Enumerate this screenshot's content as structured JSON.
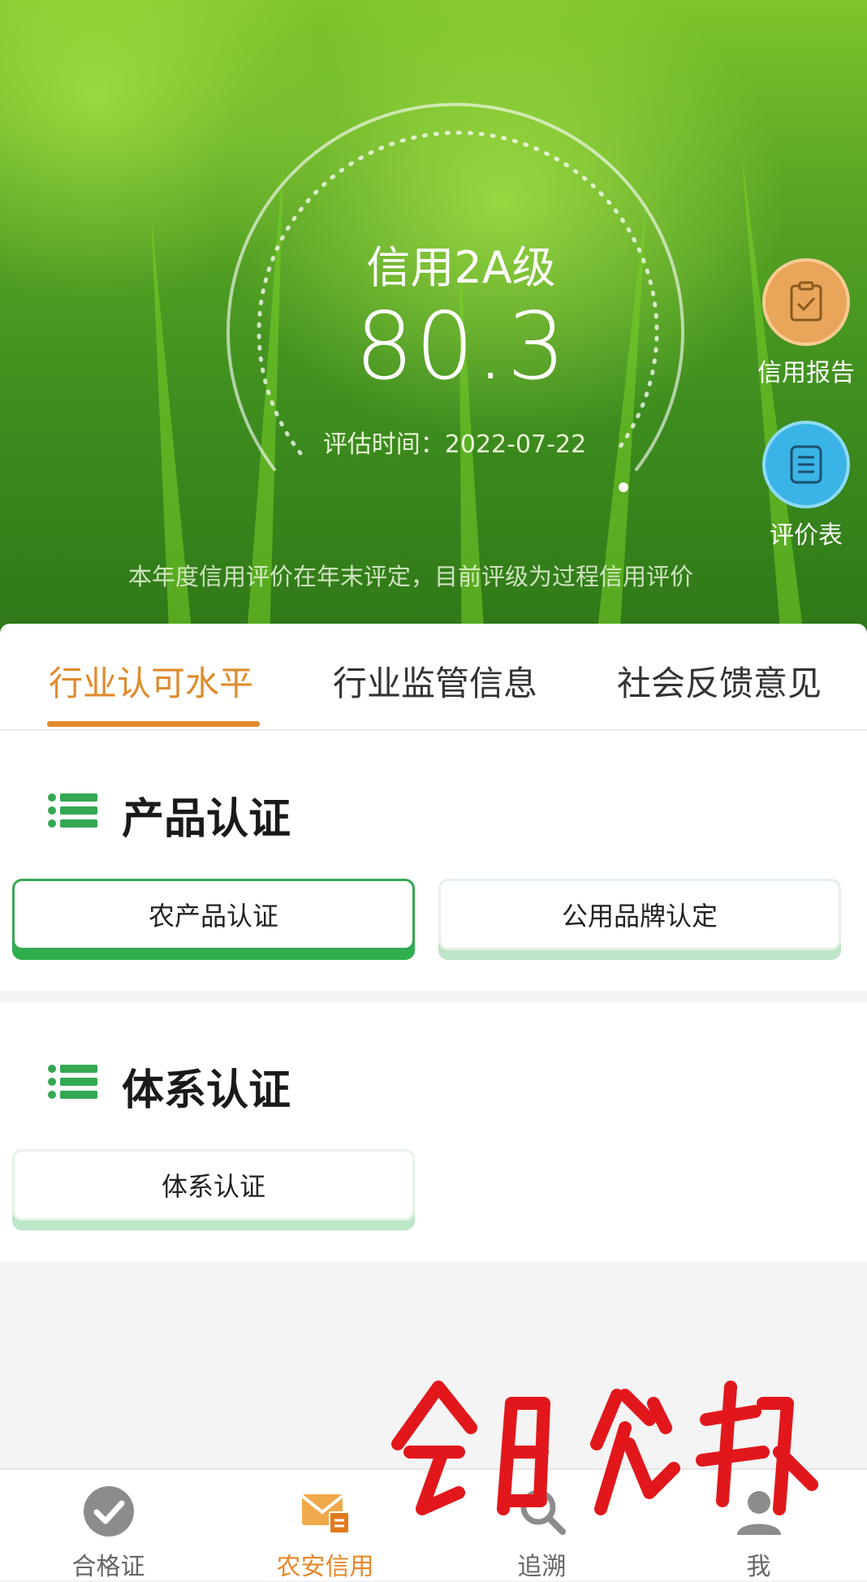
{
  "hero": {
    "credit_level": "信用2A级",
    "score": "80.3",
    "evaluation_time": "评估时间：2022-07-22",
    "note": "本年度信用评价在年末评定，目前评级为过程信用评价"
  },
  "side_buttons": [
    {
      "label": "信用报告",
      "icon": "clipboard-check-icon",
      "color": "#e9a55a"
    },
    {
      "label": "评价表",
      "icon": "document-list-icon",
      "color": "#3ab4e6"
    }
  ],
  "tabs": [
    {
      "label": "行业认可水平",
      "active": true
    },
    {
      "label": "行业监管信息",
      "active": false
    },
    {
      "label": "社会反馈意见",
      "active": false
    }
  ],
  "sections": [
    {
      "title": "产品认证",
      "buttons": [
        {
          "label": "农产品认证",
          "selected": true
        },
        {
          "label": "公用品牌认定",
          "selected": false
        }
      ]
    },
    {
      "title": "体系认证",
      "buttons": [
        {
          "label": "体系认证",
          "selected": false
        }
      ]
    }
  ],
  "bottom_nav": [
    {
      "label": "合格证",
      "icon": "checkmark-circle-icon",
      "active": false
    },
    {
      "label": "农安信用",
      "icon": "envelope-badge-icon",
      "active": true
    },
    {
      "label": "追溯",
      "icon": "magnifier-icon",
      "active": false
    },
    {
      "label": "我",
      "icon": "user-icon",
      "active": false
    }
  ],
  "watermark": "今日花都",
  "colors": {
    "accent": "#e08a2c",
    "green": "#34a853",
    "hero_green": "#5aa624"
  }
}
